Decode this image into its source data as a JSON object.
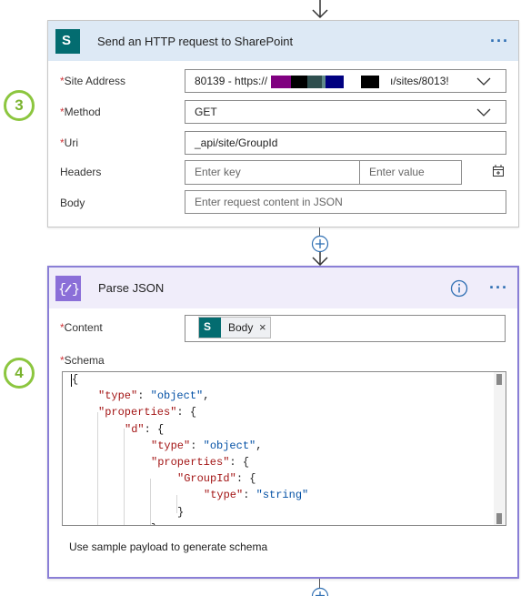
{
  "badges": [
    "3",
    "4"
  ],
  "http_action": {
    "title": "Send an HTTP request to SharePoint",
    "icon": "sharepoint-icon",
    "more_glyph": "···",
    "fields": {
      "site_address": {
        "label": "Site Address",
        "value_start": "80139 - https://",
        "value_end": "ı/sites/8013!"
      },
      "method": {
        "label": "Method",
        "value": "GET"
      },
      "uri": {
        "label": "Uri",
        "value": "_api/site/GroupId"
      },
      "headers": {
        "label": "Headers",
        "key_placeholder": "Enter key",
        "value_placeholder": "Enter value"
      },
      "body": {
        "label": "Body",
        "placeholder": "Enter request content in JSON"
      }
    },
    "redaction_colors": [
      "#800080",
      "#000000",
      "#2f4f4f",
      "#5f8a8a",
      "#000080",
      "#000000"
    ]
  },
  "parse_action": {
    "title": "Parse JSON",
    "icon": "parse-json-icon",
    "more_glyph": "···",
    "content": {
      "label": "Content",
      "token_label": "Body",
      "token_remove": "×"
    },
    "schema": {
      "label": "Schema",
      "lines": [
        {
          "indent": 0,
          "parts": [
            [
              "p",
              "{"
            ]
          ]
        },
        {
          "indent": 1,
          "parts": [
            [
              "k",
              "\"type\""
            ],
            [
              "p",
              ": "
            ],
            [
              "s",
              "\"object\""
            ],
            [
              "p",
              ","
            ]
          ]
        },
        {
          "indent": 1,
          "parts": [
            [
              "k",
              "\"properties\""
            ],
            [
              "p",
              ": {"
            ]
          ]
        },
        {
          "indent": 2,
          "parts": [
            [
              "k",
              "\"d\""
            ],
            [
              "p",
              ": {"
            ]
          ]
        },
        {
          "indent": 3,
          "parts": [
            [
              "k",
              "\"type\""
            ],
            [
              "p",
              ": "
            ],
            [
              "s",
              "\"object\""
            ],
            [
              "p",
              ","
            ]
          ]
        },
        {
          "indent": 3,
          "parts": [
            [
              "k",
              "\"properties\""
            ],
            [
              "p",
              ": {"
            ]
          ]
        },
        {
          "indent": 4,
          "parts": [
            [
              "k",
              "\"GroupId\""
            ],
            [
              "p",
              ": {"
            ]
          ]
        },
        {
          "indent": 5,
          "parts": [
            [
              "k",
              "\"type\""
            ],
            [
              "p",
              ": "
            ],
            [
              "s",
              "\"string\""
            ]
          ]
        },
        {
          "indent": 4,
          "parts": [
            [
              "p",
              "}"
            ]
          ]
        },
        {
          "indent": 3,
          "parts": [
            [
              "p",
              "}"
            ]
          ]
        }
      ]
    },
    "sample_payload_link": "Use sample payload to generate schema"
  },
  "required_marker": "*",
  "colors": {
    "http_header": "#dde9f5",
    "parse_header": "#f0edfa",
    "parse_border": "#8a7fd6",
    "sharepoint": "#036c70",
    "parse_icon": "#8b6fd8",
    "badge_green": "#8cc63f",
    "json_key": "#a31515",
    "json_string": "#0451a5",
    "more_dots": "#2f6fb3"
  }
}
